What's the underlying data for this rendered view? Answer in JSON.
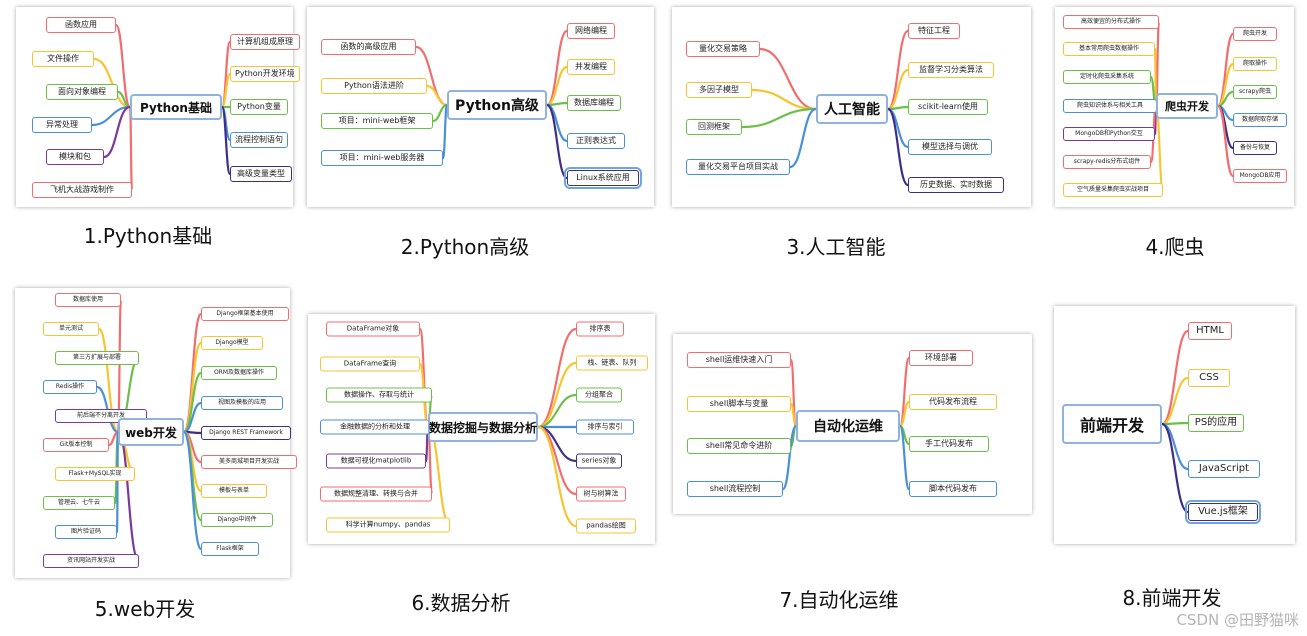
{
  "panels": [
    {
      "id": "p1",
      "caption": "1.Python基础",
      "center": "Python基础",
      "left": [
        "函数应用",
        "文件操作",
        "面向对象编程",
        "异常处理",
        "模块和包",
        "飞机大战游戏制作"
      ],
      "right": [
        "计算机组成原理",
        "Python开发环境",
        "Python变量",
        "流程控制语句",
        "高级变量类型"
      ]
    },
    {
      "id": "p2",
      "caption": "2.Python高级",
      "center": "Python高级",
      "left": [
        "函数的高级应用",
        "Python语法进阶",
        "项目：mini-web框架",
        "项目：mini-web服务器"
      ],
      "right": [
        "网络编程",
        "并发编程",
        "数据库编程",
        "正则表达式",
        "Linux系统应用"
      ]
    },
    {
      "id": "p3",
      "caption": "3.人工智能",
      "center": "人工智能",
      "left": [
        "量化交易策略",
        "多因子模型",
        "回测框架",
        "量化交易平台项目实战"
      ],
      "right": [
        "特征工程",
        "监督学习分类算法",
        "scikit-learn使用",
        "模型选择与调优",
        "历史数据、实时数据"
      ]
    },
    {
      "id": "p4",
      "caption": "4.爬虫",
      "center": "爬虫开发",
      "left": [
        "高效便宜的分布式操作",
        "基本常用爬虫数据操作",
        "定时化爬虫采集系统",
        "爬虫知识体系与相关工具",
        "MongoDB和Python交互",
        "scrapy-redis分布式组件",
        "空气质量采集爬虫实战项目"
      ],
      "right": [
        "爬虫开发",
        "爬取操作",
        "scrapy爬虫",
        "数据爬取存储",
        "备份与恢复",
        "MongoDB应用"
      ]
    },
    {
      "id": "p5",
      "caption": "5.web开发",
      "center": "web开发",
      "left": [
        "数据库使用",
        "单元测试",
        "第三方扩展与部署",
        "Redis操作",
        "前后端不分离开发",
        "Git版本控制",
        "Flask+MySQL实现",
        "管理云、七牛云",
        "图片验证码",
        "资讯网站开发实战"
      ],
      "right": [
        "Django框架基本使用",
        "Django模型",
        "ORM及数据库操作",
        "视图及模板的应用",
        "Django REST Framework",
        "美多商城项目开发实战",
        "模板与表单",
        "Django中间件",
        "Flask框架"
      ]
    },
    {
      "id": "p6",
      "caption": "6.数据分析",
      "center": "数据挖掘与数据分析",
      "left": [
        "DataFrame对象",
        "DataFrame查询",
        "数据操作、存取与统计",
        "金融数据的分析和处理",
        "数据可视化matplotlib",
        "数据规整清理、转换与合并",
        "科学计算numpy、pandas"
      ],
      "right": [
        "排序表",
        "栈、链表、队列",
        "分组聚合",
        "排序与索引",
        "series对象",
        "树与树算法",
        "pandas绘图"
      ]
    },
    {
      "id": "p7",
      "caption": "7.自动化运维",
      "center": "自动化运维",
      "left": [
        "shell运维快速入门",
        "shell脚本与变量",
        "shell常见命令进阶",
        "shell流程控制"
      ],
      "right": [
        "环境部署",
        "代码发布流程",
        "手工代码发布",
        "脚本代码发布"
      ]
    },
    {
      "id": "p8",
      "caption": "8.前端开发",
      "center": "前端开发",
      "left": [],
      "right": [
        "HTML",
        "CSS",
        "PS的应用",
        "JavaScript",
        "Vue.js框架"
      ]
    }
  ],
  "watermark": "CSDN @田野猫咪",
  "colors": {
    "branch": [
      "#f26d6d",
      "#f7c531",
      "#6cc04a",
      "#4a90d9",
      "#7a3b98",
      "#f26d6d",
      "#f7c531",
      "#6cc04a",
      "#4a90d9",
      "#7a3b98"
    ],
    "right_branch": [
      "#f26d6d",
      "#f7c531",
      "#6cc04a",
      "#4a90d9",
      "#3f2d8a",
      "#f26d6d",
      "#f7c531",
      "#6cc04a",
      "#4a90d9"
    ],
    "center_border": "#8fb2de"
  }
}
